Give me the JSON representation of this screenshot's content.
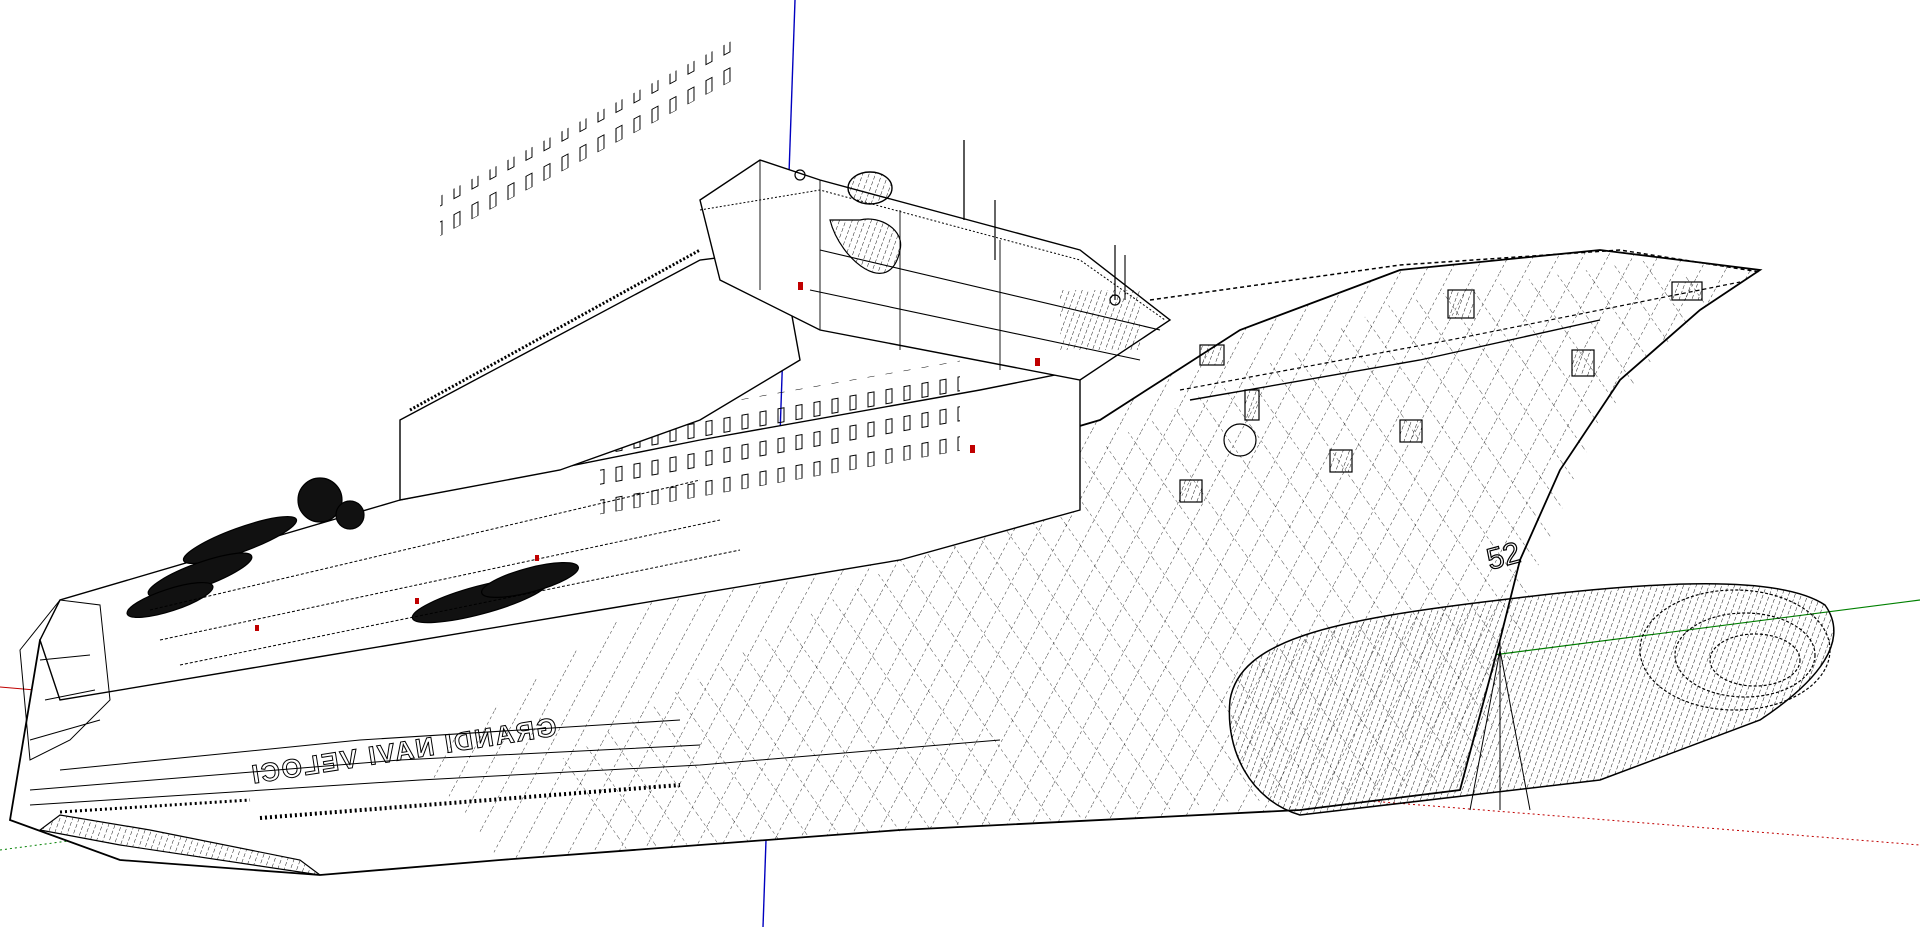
{
  "viewport": {
    "render_mode": "wireframe / hidden-line",
    "background": "#ffffff",
    "edge_color": "#000000"
  },
  "axes": {
    "red": "#c00000",
    "green": "#008000",
    "blue": "#0000c0"
  },
  "model": {
    "subject": "ship-model",
    "hull_name": "GRANDI NAVI VELOCI",
    "bow_mark": "52"
  }
}
